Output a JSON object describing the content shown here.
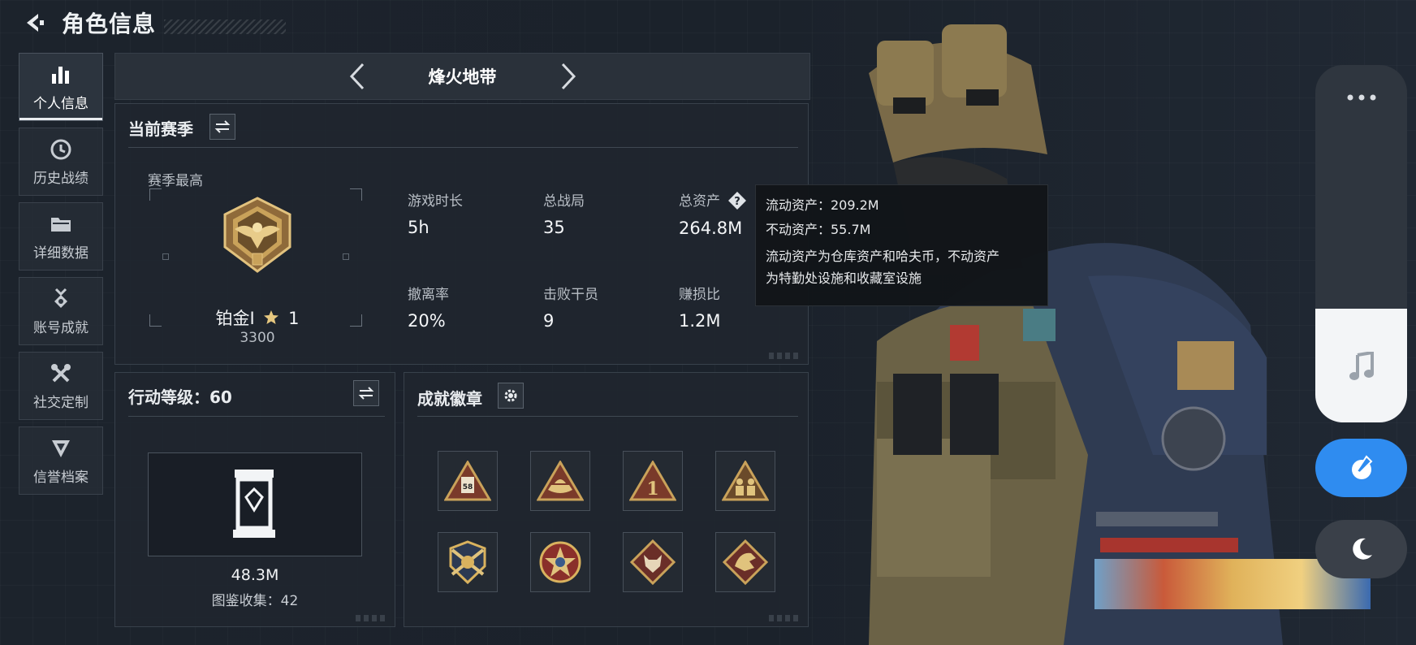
{
  "header": {
    "title": "角色信息"
  },
  "sidebar": {
    "items": [
      {
        "label": "个人信息",
        "icon": "bar-chart-icon",
        "active": true
      },
      {
        "label": "历史战绩",
        "icon": "clock-icon"
      },
      {
        "label": "详细数据",
        "icon": "folder-icon"
      },
      {
        "label": "账号成就",
        "icon": "medal-icon"
      },
      {
        "label": "社交定制",
        "icon": "tools-icon"
      },
      {
        "label": "信誉档案",
        "icon": "shield-icon"
      }
    ]
  },
  "mode": {
    "name": "烽火地带"
  },
  "season": {
    "title": "当前赛季",
    "best_label": "赛季最高",
    "rank_name": "铂金Ⅰ",
    "rank_stars": "1",
    "rank_score": "3300",
    "stats": [
      {
        "label": "游戏时长",
        "value": "5h"
      },
      {
        "label": "总战局",
        "value": "35"
      },
      {
        "label": "总资产",
        "value": "264.8M"
      },
      {
        "label": "撤离率",
        "value": "20%"
      },
      {
        "label": "击败干员",
        "value": "9"
      },
      {
        "label": "赚损比",
        "value": "1.2M"
      }
    ]
  },
  "tooltip": {
    "liquid": "流动资产：209.2M",
    "fixed": "不动资产：55.7M",
    "desc_line1": "流动资产为仓库资产和哈夫币，不动资产",
    "desc_line2": "为特勤处设施和收藏室设施"
  },
  "level": {
    "title": "行动等级：60",
    "handbook_value": "48.3M",
    "handbook_count": "图鉴收集：42"
  },
  "badges": {
    "title": "成就徽章",
    "items": [
      "badge-58",
      "badge-boat",
      "badge-first",
      "badge-squad",
      "badge-rifles",
      "badge-star",
      "badge-wolf",
      "badge-dragon"
    ]
  },
  "colors": {
    "background": "#1c232c",
    "panel": "#1f262f",
    "gold": "#c9a25a",
    "accent_blue": "#2f8cf0"
  }
}
